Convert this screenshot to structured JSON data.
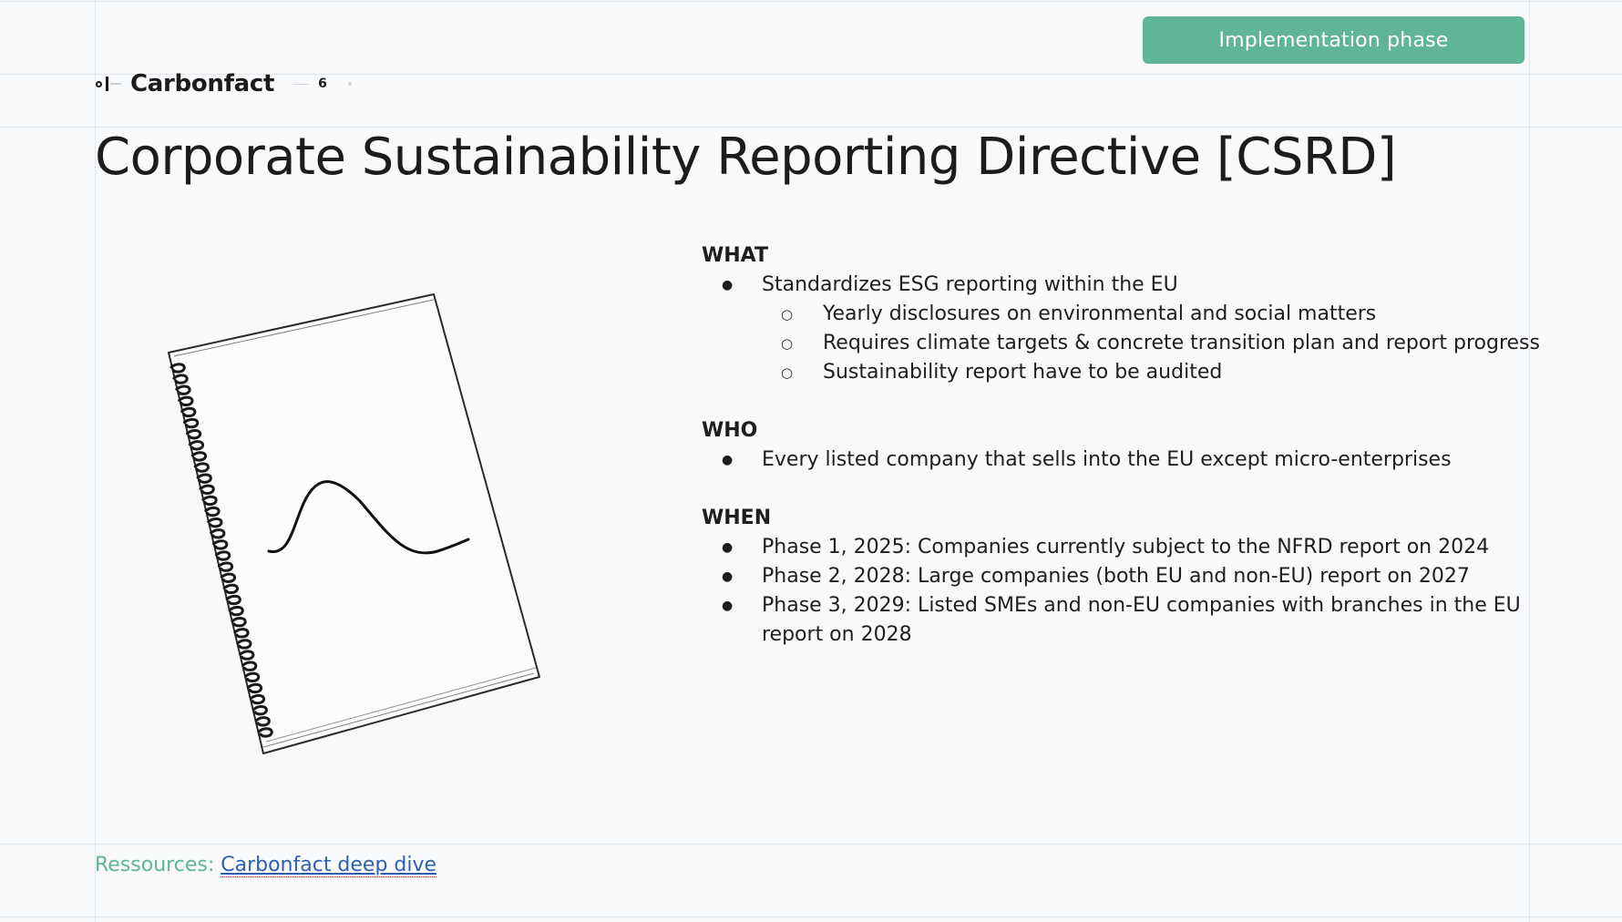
{
  "header": {
    "phase_button_label": "Implementation phase",
    "brand_name": "Carbonfact",
    "slide_number": "6"
  },
  "title": "Corporate Sustainability Reporting Directive [CSRD]",
  "sections": {
    "what": {
      "heading": "WHAT",
      "bullet": "Standardizes ESG reporting within the EU",
      "sub_bullets": [
        "Yearly disclosures on environmental and social matters",
        "Requires climate targets & concrete transition plan and report progress",
        "Sustainability report have to be audited"
      ]
    },
    "who": {
      "heading": "WHO",
      "bullet": "Every listed company that sells into the EU except micro-enterprises"
    },
    "when": {
      "heading": "WHEN",
      "bullets": [
        "Phase 1, 2025: Companies currently subject to the NFRD report on 2024",
        "Phase 2, 2028: Large companies (both EU and non-EU) report on 2027",
        "Phase 3, 2029: Listed SMEs and non-EU companies with branches in the EU report on 2028"
      ]
    }
  },
  "footer": {
    "resources_label": "Ressources: ",
    "resources_link": "Carbonfact deep dive"
  },
  "colors": {
    "accent_green": "#5fb596",
    "link_blue": "#2e5fb3",
    "background": "#f8f9fb"
  },
  "icons": [
    "carbonfact-logo-icon",
    "notebook-sketch-icon"
  ]
}
